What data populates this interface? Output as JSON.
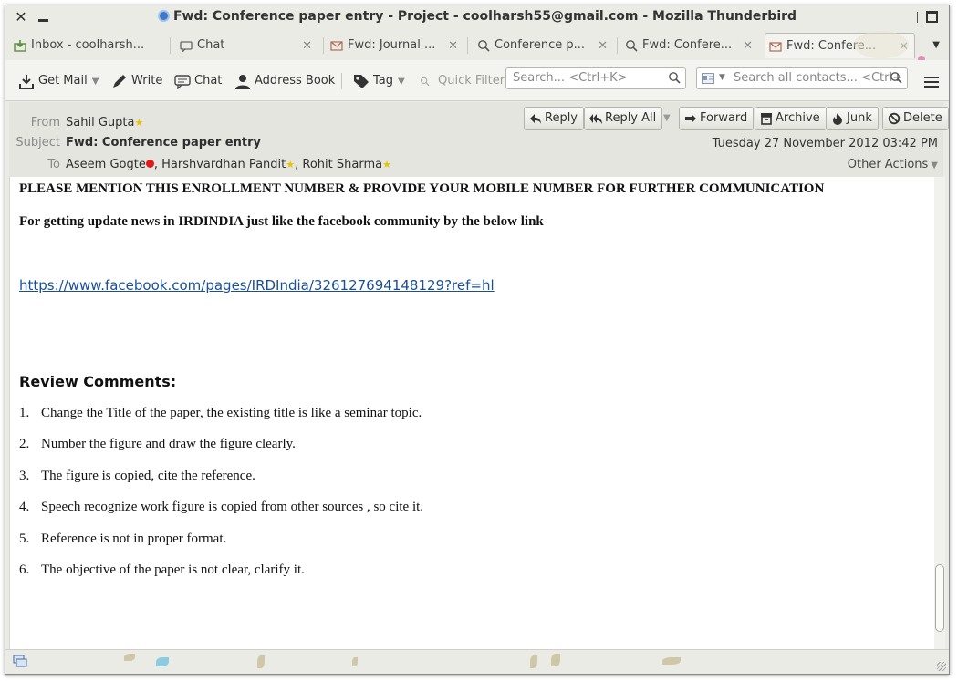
{
  "window": {
    "title": "Fwd: Conference paper entry - Project - coolharsh55@gmail.com - Mozilla Thunderbird"
  },
  "tabs": [
    {
      "label": "Inbox - coolharsh...",
      "icon": "inbox-icon"
    },
    {
      "label": "Chat",
      "icon": "chat-icon"
    },
    {
      "label": "Fwd: Journal ...",
      "icon": "envelope-icon"
    },
    {
      "label": "Conference p...",
      "icon": "search-icon"
    },
    {
      "label": "Fwd: Confere...",
      "icon": "search-icon"
    },
    {
      "label": "Fwd: Confere...",
      "icon": "envelope-icon",
      "active": true
    }
  ],
  "toolbar": {
    "get_mail": "Get Mail",
    "write": "Write",
    "chat": "Chat",
    "address_book": "Address Book",
    "tag": "Tag",
    "quick_filter": "Quick Filter",
    "search_placeholder": "Search... <Ctrl+K>",
    "contacts_placeholder": "Search all contacts... <Ctrl+"
  },
  "header": {
    "from_label": "From",
    "from": "Sahil Gupta",
    "subject_label": "Subject",
    "subject": "Fwd: Conference paper entry",
    "to_label": "To",
    "to": [
      "Aseem Gogte",
      "Harshvardhan Pandit",
      "Rohit Sharma"
    ],
    "date": "Tuesday 27 November 2012 03:42 PM",
    "other_actions": "Other Actions",
    "buttons": {
      "reply": "Reply",
      "reply_all": "Reply All",
      "forward": "Forward",
      "archive": "Archive",
      "junk": "Junk",
      "delete": "Delete"
    }
  },
  "message": {
    "line1": "PLEASE MENTION THIS ENROLLMENT  NUMBER & PROVIDE YOUR MOBILE NUMBER FOR FURTHER COMMUNICATION",
    "line2": "For getting update news in IRDINDIA just like the facebook community by the below link",
    "link": "https://www.facebook.com/pages/IRDIndia/326127694148129?ref=hl",
    "review_heading": "Review Comments:",
    "comments": [
      {
        "num": "1.",
        "text": "Change the Title of the paper, the existing title is like a seminar topic."
      },
      {
        "num": "2.",
        "text": "Number the figure and draw the figure clearly."
      },
      {
        "num": "3.",
        "text": "The figure is copied, cite the reference."
      },
      {
        "num": "4.",
        "text": "Speech recognize work figure is copied  from other sources , so cite it."
      },
      {
        "num": "5.",
        "text": "Reference is not in proper format."
      },
      {
        "num": "6.",
        "text": "The objective of the paper is not clear, clarify it."
      }
    ]
  },
  "colors": {
    "link": "#1a4f97",
    "star": "#e8c200",
    "status_dot": "#e01b1b"
  }
}
